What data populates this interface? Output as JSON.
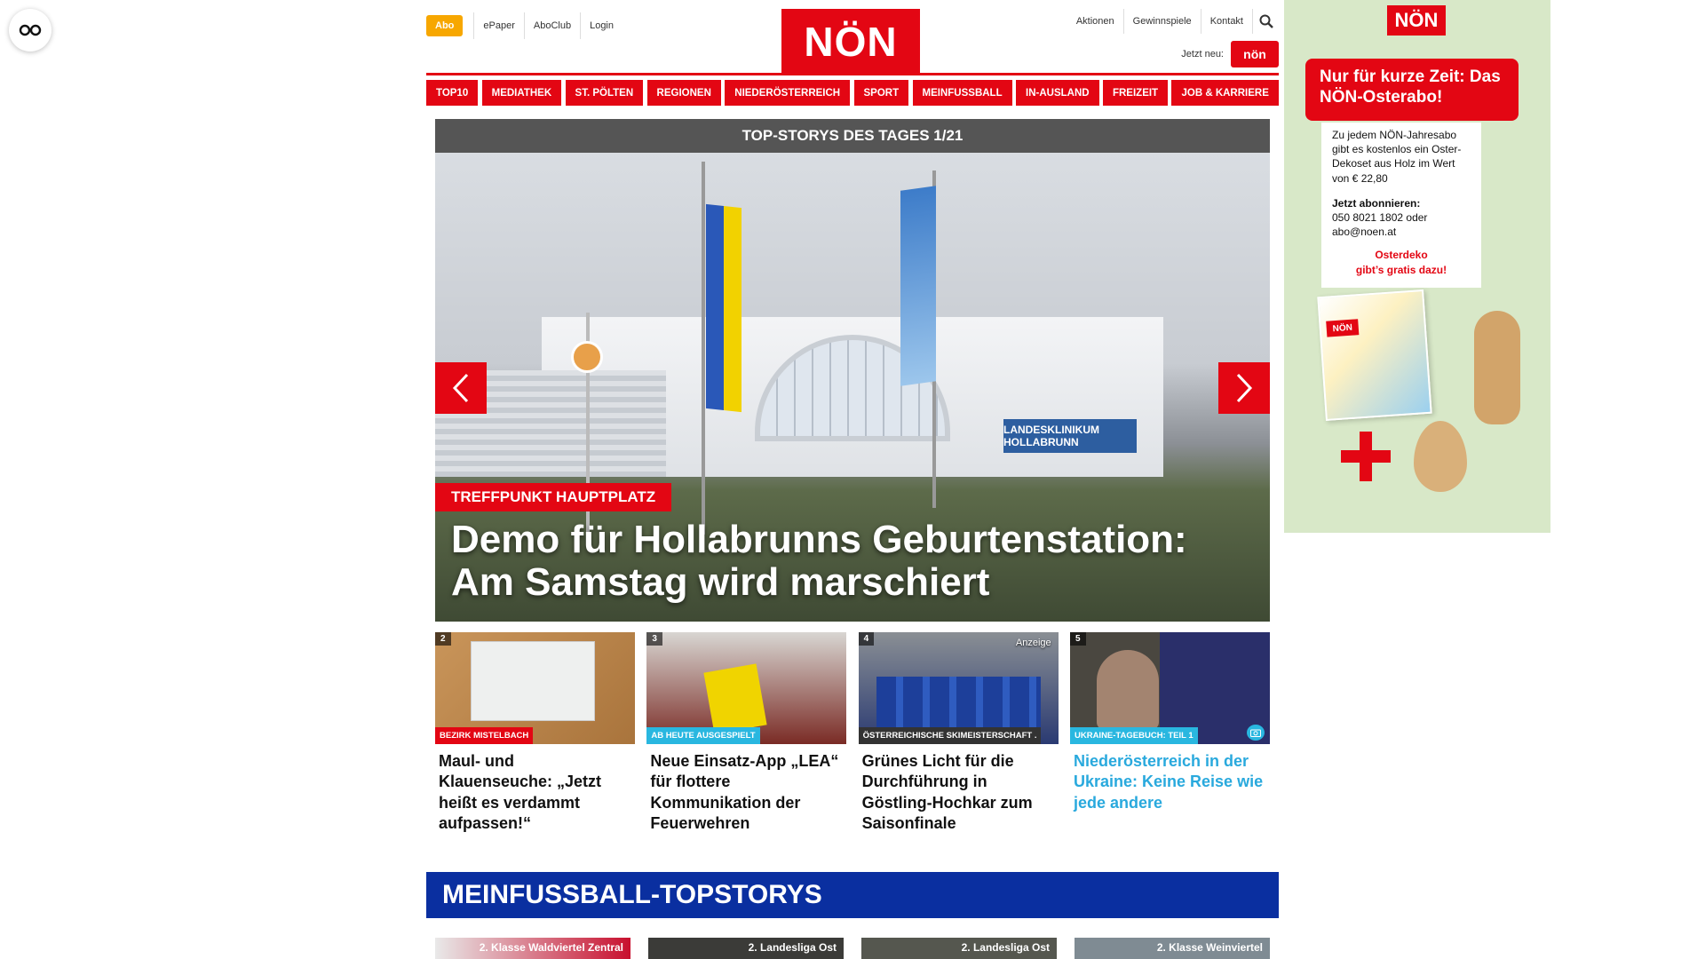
{
  "accessibility": {
    "icon": "glasses-icon"
  },
  "header": {
    "abo_label": "Abo",
    "left_links": [
      "ePaper",
      "AboClub",
      "Login"
    ],
    "logo_text": "NÖN",
    "right_links": [
      "Aktionen",
      "Gewinnspiele",
      "Kontakt"
    ],
    "jetzt_neu": "Jetzt neu:",
    "mini_logo": "nön"
  },
  "nav": [
    "TOP10",
    "MEDIATHEK",
    "ST. PÖLTEN",
    "REGIONEN",
    "NIEDERÖSTERREICH",
    "SPORT",
    "MEINFUSSBALL",
    "IN-AUSLAND",
    "FREIZEIT",
    "JOB & KARRIERE"
  ],
  "slider": {
    "bar_title": "TOP-STORYS DES TAGES 1/21",
    "category": "TREFFPUNKT HAUPTPLATZ",
    "title": "Demo für Hollabrunns Geburtenstation: Am Samstag wird marschiert",
    "building_sign": "LANDESKLINIKUM HOLLABRUNN"
  },
  "teasers": [
    {
      "num": "2",
      "tag": "BEZIRK MISTELBACH",
      "tag_color": "#e30613",
      "title": "Maul- und Klauenseuche: „Jetzt heißt es verdammt aufpassen!“",
      "highlight": false
    },
    {
      "num": "3",
      "tag": "AB HEUTE AUSGESPIELT",
      "tag_color": "#29b7e0",
      "title": "Neue Einsatz-App „LEA“ für flottere Kommunikation der Feuerwehren",
      "highlight": false
    },
    {
      "num": "4",
      "tag": "ÖSTERREICHISCHE SKIMEISTERSCHAFT .",
      "tag_color": "#333333",
      "title": "Grünes Licht für die Durchführung in Göstling-Hochkar zum Saisonfinale",
      "ad_label": "Anzeige",
      "highlight": false
    },
    {
      "num": "5",
      "tag": "UKRAINE-TAGEBUCH: TEIL 1",
      "tag_color": "#29b7e0",
      "title": "Niederösterreich in der Ukraine: Keine Reise wie jede andere",
      "highlight": true
    }
  ],
  "meinfussball": {
    "title": "MEINFUSSBALL-TOPSTORYS",
    "cards": [
      "2. Klasse Waldviertel Zentral",
      "2. Landesliga Ost",
      "2. Landesliga Ost",
      "2. Klasse Weinviertel"
    ]
  },
  "ad": {
    "logo": "NÖN",
    "headline": "Nur für kurze Zeit: Das NÖN-Osterabo!",
    "body": "Zu jedem NÖN-Jahresabo gibt es kostenlos ein Oster-Dekoset aus Holz im Wert von € 22,80",
    "cta_title": "Jetzt abonnieren:",
    "cta_body": "050 8021 1802 oder abo@noen.at",
    "red_line1": "Osterdeko",
    "red_line2": "gibt’s gratis dazu!",
    "mag_logo": "NÖN"
  },
  "colors": {
    "brand_red": "#e30613",
    "abo_orange": "#f7a700",
    "mf_blue": "#0a2fa0",
    "highlight_blue": "#29a9dd"
  }
}
